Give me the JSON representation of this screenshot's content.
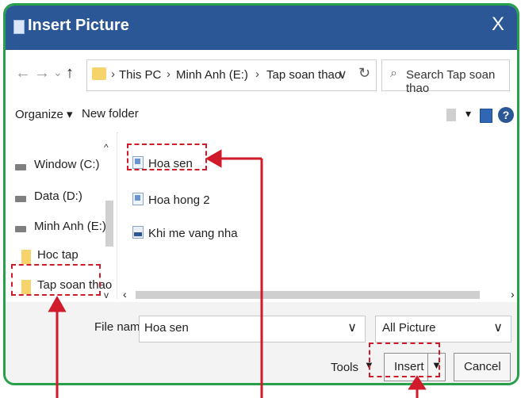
{
  "dialog": {
    "title": "Insert Picture",
    "close_glyph": "X"
  },
  "address_bar": {
    "back_glyph": "←",
    "forward_glyph": "→",
    "recent_glyph": "⌄",
    "up_glyph": "↑",
    "breadcrumbs": [
      "This PC",
      "Minh Anh (E:)",
      "Tap soan thao"
    ],
    "separator": "›",
    "dropdown_glyph": "∨",
    "refresh_glyph": "↻"
  },
  "search": {
    "icon": "⌕",
    "placeholder": "Search Tap soan thao"
  },
  "toolbar": {
    "organize_label": "Organize",
    "organize_dd": "▾",
    "new_folder_label": "New folder",
    "view_dd": "▾",
    "help_glyph": "?"
  },
  "navigation": {
    "items": [
      {
        "label": "Window (C:)",
        "type": "drive"
      },
      {
        "label": "Data (D:)",
        "type": "drive"
      },
      {
        "label": "Minh Anh (E:)",
        "type": "drive"
      },
      {
        "label": "Hoc tap",
        "type": "folder"
      },
      {
        "label": "Tap soan thao",
        "type": "folder",
        "selected": true
      }
    ],
    "scroll_up": "^",
    "scroll_down": "v"
  },
  "files": {
    "items": [
      {
        "name": "Hoa sen",
        "type": "image"
      },
      {
        "name": "Hoa hong 2",
        "type": "image"
      },
      {
        "name": "Khi me vang nha",
        "type": "image"
      }
    ]
  },
  "horizontal_scroll": {
    "left": "‹",
    "right": "›"
  },
  "bottom": {
    "file_name_label": "File name",
    "file_name_value": "Hoa sen",
    "file_name_dd": "∨",
    "filter_value": "All Picture",
    "filter_dd": "∨",
    "tools_label": "Tools",
    "tools_dd": "▼",
    "insert_label": "Insert",
    "insert_dd": "▼",
    "cancel_label": "Cancel"
  },
  "annotation_color": "#d11a2a"
}
